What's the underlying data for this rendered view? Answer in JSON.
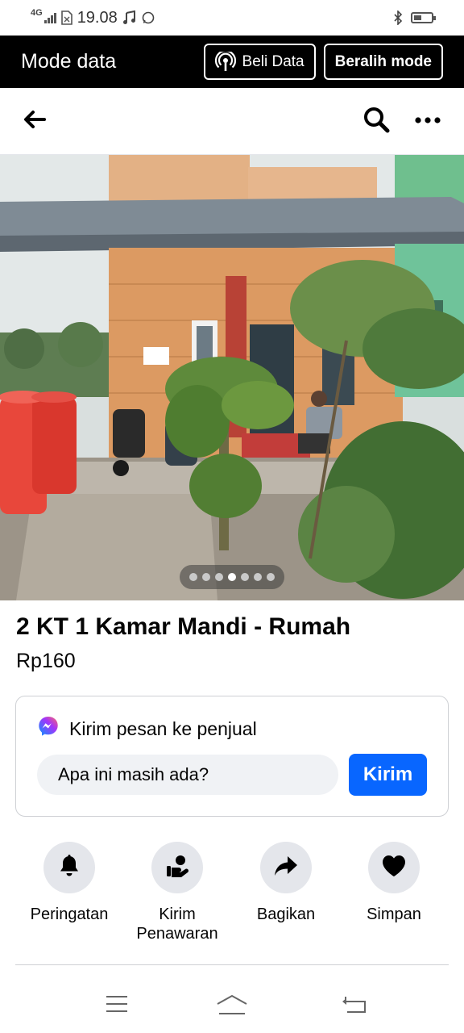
{
  "status_bar": {
    "network": "4G",
    "time": "19.08",
    "left_icons": [
      "signal-icon",
      "sim-icon",
      "music-icon",
      "whatsapp-icon"
    ],
    "right_icons": [
      "bluetooth-icon",
      "battery-icon"
    ]
  },
  "data_mode_bar": {
    "title": "Mode data",
    "buy_data_label": "Beli Data",
    "switch_mode_label": "Beralih mode"
  },
  "top_nav": {
    "icons": [
      "back-arrow-icon",
      "search-icon",
      "more-icon"
    ]
  },
  "gallery": {
    "photo_count": 7,
    "active_index": 3
  },
  "listing": {
    "title": "2 KT 1 Kamar Mandi - Rumah",
    "price": "Rp160"
  },
  "message_card": {
    "heading": "Kirim pesan ke penjual",
    "input_value": "Apa ini masih ada?",
    "send_label": "Kirim"
  },
  "actions": [
    {
      "label": "Peringatan",
      "icon": "bell-icon"
    },
    {
      "label": "Kirim Penawaran",
      "icon": "offer-icon"
    },
    {
      "label": "Bagikan",
      "icon": "share-icon"
    },
    {
      "label": "Simpan",
      "icon": "heart-icon"
    }
  ],
  "colors": {
    "accent": "#0866ff",
    "data_bar": "#000000",
    "action_circle": "#e4e6eb"
  }
}
